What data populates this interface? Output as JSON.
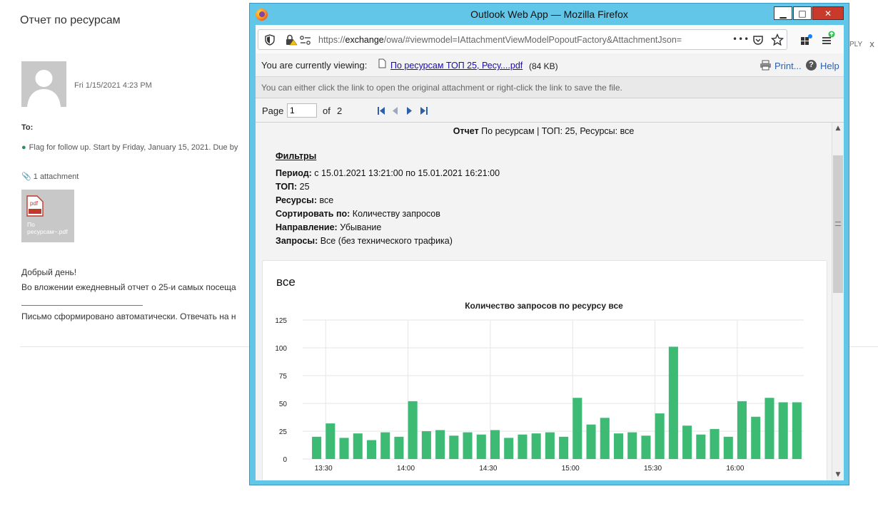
{
  "email": {
    "subject": "Отчет по ресурсам",
    "date": "Fri 1/15/2021 4:23 PM",
    "to_label": "To:",
    "flag_text": "Flag for follow up. Start by Friday, January 15, 2021. Due by",
    "attachment_count": "1 attachment",
    "attachment_badge": "pdf",
    "attachment_name": "По ресурсам~.pdf",
    "body_greeting": "Добрый день!",
    "body_line": "Во вложении ежедневный отчет о 25-и самых посеща",
    "body_footer": "Письмо сформировано автоматически. Отвечать на н",
    "reply_fragment": "PLY",
    "close_fragment": "x"
  },
  "window": {
    "title": "Outlook Web App — Mozilla Firefox",
    "min": "▁",
    "max": "□",
    "close": "✕"
  },
  "browser": {
    "url_prefix": "https://",
    "url_host": "exchange",
    "url_rest": "/owa/#viewmodel=IAttachmentViewModelPopoutFactory&AttachmentJson=",
    "more": "•••"
  },
  "viewer": {
    "viewing_label": "You are currently viewing:",
    "file_link": "По ресурсам ТОП 25, Ресу....pdf",
    "file_size": "(84 KB)",
    "print": "Print...",
    "help": "Help",
    "hint": "You can either click the link to open the original attachment or right-click the link to save the file.",
    "page_label": "Page",
    "page_value": "1",
    "of_label": "of",
    "total_pages": "2"
  },
  "report": {
    "header_bold": "Отчет",
    "header_rest": " По ресурсам | ТОП: 25, Ресурсы: все",
    "filters_title": "Фильтры",
    "lines": [
      {
        "label": "Период:",
        "value": " с 15.01.2021 13:21:00 по 15.01.2021 16:21:00"
      },
      {
        "label": "ТОП:",
        "value": " 25"
      },
      {
        "label": "Ресурсы:",
        "value": " все"
      },
      {
        "label": "Сортировать по:",
        "value": " Количеству запросов"
      },
      {
        "label": "Направление:",
        "value": " Убывание"
      },
      {
        "label": "Запросы:",
        "value": " Все (без технического трафика)"
      }
    ],
    "card_title": "все"
  },
  "colors": {
    "bar": "#3dbb75",
    "window_frame": "#62c6e8",
    "link": "#1a0dab"
  },
  "chart_data": {
    "type": "bar",
    "title": "Количество запросов по ресурсу все",
    "xlabel": "",
    "ylabel": "",
    "ylim": [
      0,
      125
    ],
    "yticks": [
      0,
      25,
      50,
      75,
      100,
      125
    ],
    "xticks": [
      "13:30",
      "14:00",
      "14:30",
      "15:00",
      "15:30",
      "16:00"
    ],
    "grid": true,
    "values": [
      20,
      32,
      19,
      23,
      17,
      24,
      20,
      52,
      25,
      26,
      21,
      24,
      22,
      26,
      19,
      22,
      23,
      24,
      20,
      55,
      31,
      37,
      23,
      24,
      21,
      41,
      101,
      30,
      22,
      27,
      20,
      52,
      38,
      55,
      51,
      51
    ]
  }
}
